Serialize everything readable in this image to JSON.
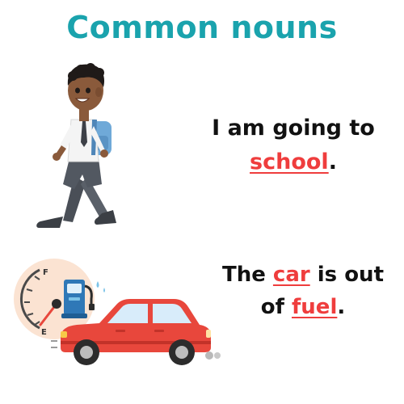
{
  "title": "Common nouns",
  "examples": [
    {
      "parts": [
        "I am going to",
        "school",
        "."
      ],
      "noun": "school",
      "illustration_icon": "walking-schoolboy-illustration"
    },
    {
      "parts": [
        "The ",
        "car",
        " is out",
        "of ",
        "fuel",
        "."
      ],
      "nouns": [
        "car",
        "fuel"
      ],
      "illustration_icon": "car-out-of-fuel-illustration"
    }
  ],
  "gauge": {
    "full_label": "F",
    "empty_label": "E"
  },
  "colors": {
    "title": "#1aa3ad",
    "noun_highlight": "#ef3d3d",
    "text": "#111111",
    "car_body": "#e8473c"
  }
}
